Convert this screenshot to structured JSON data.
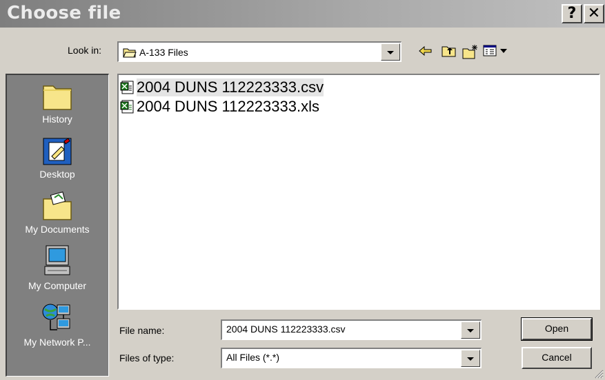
{
  "window": {
    "title": "Choose file",
    "help_label": "?",
    "close_label": "✕"
  },
  "look_in": {
    "label": "Look in:",
    "value": "A-133 Files"
  },
  "toolbar": {
    "back_icon": "back-arrow-icon",
    "up_icon": "up-folder-icon",
    "new_folder_icon": "new-folder-icon",
    "view_menu_icon": "view-menu-icon"
  },
  "places": [
    {
      "label": "History",
      "icon": "history-folder-icon"
    },
    {
      "label": "Desktop",
      "icon": "desktop-icon"
    },
    {
      "label": "My Documents",
      "icon": "my-documents-icon"
    },
    {
      "label": "My Computer",
      "icon": "my-computer-icon"
    },
    {
      "label": "My Network P...",
      "icon": "network-places-icon"
    }
  ],
  "files": [
    {
      "name": "2004 DUNS 112223333.csv",
      "icon": "excel-csv-icon",
      "selected": true
    },
    {
      "name": "2004 DUNS 112223333.xls",
      "icon": "excel-xls-icon",
      "selected": false
    }
  ],
  "file_name": {
    "label": "File name:",
    "value": "2004 DUNS 112223333.csv"
  },
  "file_type": {
    "label": "Files of type:",
    "value": "All Files (*.*)"
  },
  "buttons": {
    "open": "Open",
    "cancel": "Cancel"
  },
  "colors": {
    "titlebar_start": "#7e7e7e",
    "face": "#d4d0c8",
    "places_bg": "#808080"
  }
}
